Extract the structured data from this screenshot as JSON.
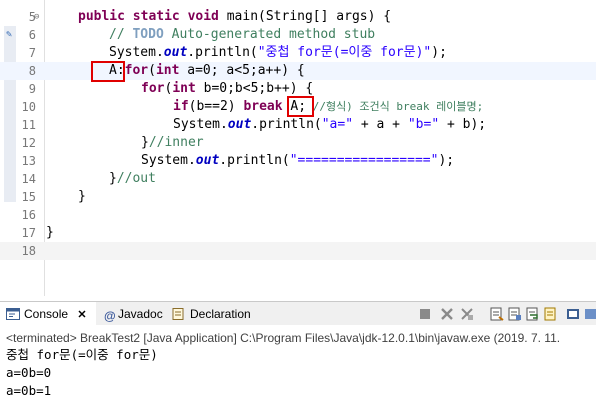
{
  "editor": {
    "line_numbers": [
      "5",
      "6",
      "7",
      "8",
      "9",
      "10",
      "11",
      "12",
      "13",
      "14",
      "15",
      "16",
      "17",
      "18"
    ],
    "line5": {
      "p1": "public static void ",
      "p2": "main(String[] args) {"
    },
    "line6": {
      "p1": "// ",
      "todo": "TODO",
      "p2": " Auto-generated method stub"
    },
    "line7": {
      "sys": "System.",
      "out": "out",
      "mid": ".println(",
      "str": "\"중첩 for문(=이중 for문)\"",
      "end": ");"
    },
    "line8": {
      "label": "A:",
      "kw": "for",
      "p1": "(",
      "kw2": "int",
      "p2": " a=0; a<5;a++) {"
    },
    "line9": {
      "kw": "for",
      "p1": "(",
      "kw2": "int",
      "p2": " b=0;b<5;b++) {"
    },
    "line10": {
      "kw": "if",
      "p1": "(b==2) ",
      "kw2": "break",
      "p2": " ",
      "label": "A;",
      "cm": " //형식) 조건식 break 레이블명;"
    },
    "line11": {
      "sys": "System.",
      "out": "out",
      "mid": ".println(",
      "s1": "\"a=\"",
      "p1": " + a + ",
      "s2": "\"b=\"",
      "p2": " + b);"
    },
    "line12": {
      "p1": "}",
      "cm": "//inner"
    },
    "line13": {
      "sys": "System.",
      "out": "out",
      "mid": ".println(",
      "str": "\"=================\"",
      "end": ");"
    },
    "line14": {
      "p1": "}",
      "cm": "//out"
    },
    "line15": {
      "p1": "}"
    },
    "line17": {
      "p1": "}"
    }
  },
  "console": {
    "tabs": [
      {
        "label": "Console",
        "icon": "console-icon"
      },
      {
        "label": "Javadoc",
        "icon": "javadoc-icon"
      },
      {
        "label": "Declaration",
        "icon": "declaration-icon"
      }
    ],
    "close_glyph": "✕",
    "terminated_line": "<terminated> BreakTest2 [Java Application] C:\\Program Files\\Java\\jdk-12.0.1\\bin\\javaw.exe (2019. 7. 11.",
    "output": [
      "중첩 for문(=이중 for문)",
      "a=0b=0",
      "a=0b=1"
    ]
  },
  "colors": {
    "keyword": "#7f0055",
    "string": "#2a00ff",
    "comment": "#3f7f5f",
    "field": "#0000c0",
    "highlight_box": "#e00000"
  }
}
